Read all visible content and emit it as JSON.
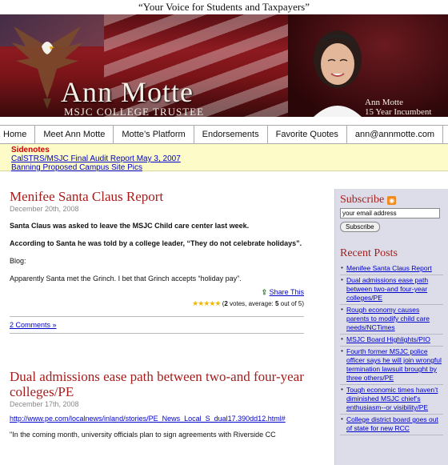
{
  "tagline": "“Your Voice for Students and Taxpayers”",
  "banner": {
    "name": "Ann Motte",
    "subtitle": "MSJC COLLEGE TRUSTEE",
    "photo_caption_1": "Ann Motte",
    "photo_caption_2": "15 Year Incumbent"
  },
  "nav": [
    "Home",
    "Meet Ann Motte",
    "Motte’s Platform",
    "Endorsements",
    "Favorite Quotes",
    "ann@annmotte.com"
  ],
  "sidenotes": {
    "heading": "Sidenotes",
    "links": [
      "CalSTRS/MSJC Final Audit Report May 3, 2007",
      "Banning Proposed Campus Site Pics"
    ]
  },
  "post1": {
    "title": "Menifee Santa Claus Report",
    "date": "December 20th, 2008",
    "p1": "Santa Claus was asked to leave the MSJC Child care center last week.",
    "p2": "According to Santa he was told by a college leader, “They do not celebrate holidays”.",
    "p3": "Blog:",
    "p4": "Apparently Santa met the Grinch.  I bet that Grinch accepts “holiday pay”.",
    "share": "Share This",
    "rating_text_pre": "(",
    "votes": "2",
    "rating_mid": " votes, average: ",
    "average": "5",
    "rating_post": " out of 5)",
    "comments": "2 Comments »"
  },
  "post2": {
    "title": "Dual admissions ease path between two-and four-year colleges/PE",
    "date": "December 17th, 2008",
    "url": "http://www.pe.com/localnews/inland/stories/PE_News_Local_S_dual17.390dd12.html#",
    "trunc": "\"In the coming month, university officials plan to sign agreements with Riverside CC"
  },
  "sidebar": {
    "subscribe_heading": "Subscribe",
    "email_placeholder": "your email address",
    "subscribe_button": "Subscribe",
    "recent_heading": "Recent Posts",
    "recent": [
      "Menifee Santa Claus Report",
      "Dual admissions ease path between two-and four-year colleges/PE",
      "Rough economy causes parents to modify child care needs/NCTimes",
      "MSJC Board Highlights/PIO",
      "Fourth former MSJC police officer says he will join wrongful termination lawsuit brought by three others/PE",
      "Tough economic times haven’t diminished MSJC chief’s enthusiasm--or visibility/PE",
      "College district board goes out of state for new RCC"
    ]
  },
  "colors": {
    "accent_red": "#a41e1e",
    "link_blue": "#0000cc",
    "sidebar_bg": "#dcdde8",
    "sidenote_bg": "#fdfcc8"
  }
}
